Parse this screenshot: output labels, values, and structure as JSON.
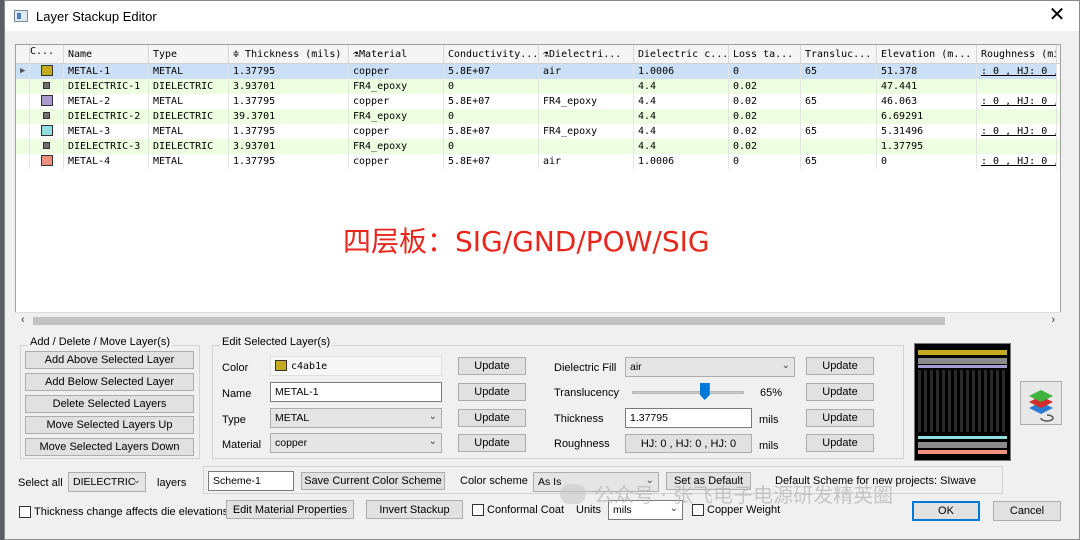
{
  "window": {
    "title": "Layer Stackup Editor"
  },
  "grid": {
    "headers": [
      "C...",
      "Name",
      "Type",
      "Thickness (mils)",
      "Material",
      "Conductivity...",
      "Dielectri...",
      "Dielectric c...",
      "Loss ta...",
      "Transluc...",
      "Elevation (m...",
      "Roughness (mi"
    ],
    "rows": [
      {
        "color": "#c4ab1e",
        "name": "METAL-1",
        "type": "METAL",
        "thickness": "1.37795",
        "material": "copper",
        "conductivity": "5.8E+07",
        "dielectric": "air",
        "dielectric_c": "1.0006",
        "loss": "0",
        "transluc": "65",
        "elevation": "51.378",
        "roughness": ": 0 , HJ: 0 ,"
      },
      {
        "color": "#707070",
        "name": "DIELECTRIC-1",
        "type": "DIELECTRIC",
        "thickness": "3.93701",
        "material": "FR4_epoxy",
        "conductivity": "0",
        "dielectric": "",
        "dielectric_c": "4.4",
        "loss": "0.02",
        "transluc": "",
        "elevation": "47.441",
        "roughness": ""
      },
      {
        "color": "#a89ad0",
        "name": "METAL-2",
        "type": "METAL",
        "thickness": "1.37795",
        "material": "copper",
        "conductivity": "5.8E+07",
        "dielectric": "FR4_epoxy",
        "dielectric_c": "4.4",
        "loss": "0.02",
        "transluc": "65",
        "elevation": "46.063",
        "roughness": ": 0 , HJ: 0 ,"
      },
      {
        "color": "#707070",
        "name": "DIELECTRIC-2",
        "type": "DIELECTRIC",
        "thickness": "39.3701",
        "material": "FR4_epoxy",
        "conductivity": "0",
        "dielectric": "",
        "dielectric_c": "4.4",
        "loss": "0.02",
        "transluc": "",
        "elevation": "6.69291",
        "roughness": ""
      },
      {
        "color": "#8ee0de",
        "name": "METAL-3",
        "type": "METAL",
        "thickness": "1.37795",
        "material": "copper",
        "conductivity": "5.8E+07",
        "dielectric": "FR4_epoxy",
        "dielectric_c": "4.4",
        "loss": "0.02",
        "transluc": "65",
        "elevation": "5.31496",
        "roughness": ": 0 , HJ: 0 ,"
      },
      {
        "color": "#707070",
        "name": "DIELECTRIC-3",
        "type": "DIELECTRIC",
        "thickness": "3.93701",
        "material": "FR4_epoxy",
        "conductivity": "0",
        "dielectric": "",
        "dielectric_c": "4.4",
        "loss": "0.02",
        "transluc": "",
        "elevation": "1.37795",
        "roughness": ""
      },
      {
        "color": "#f0907c",
        "name": "METAL-4",
        "type": "METAL",
        "thickness": "1.37795",
        "material": "copper",
        "conductivity": "5.8E+07",
        "dielectric": "air",
        "dielectric_c": "1.0006",
        "loss": "0",
        "transluc": "65",
        "elevation": "0",
        "roughness": ": 0 , HJ: 0 ,"
      }
    ]
  },
  "overlay_text": "四层板：SIG/GND/POW/SIG",
  "layers_group": {
    "label": "Add / Delete / Move Layer(s)",
    "add_above": "Add Above Selected Layer",
    "add_below": "Add Below Selected Layer",
    "delete": "Delete Selected Layers",
    "move_up": "Move Selected Layers Up",
    "move_down": "Move Selected Layers Down"
  },
  "edit_group": {
    "label": "Edit Selected Layer(s)",
    "color_label": "Color",
    "color_value": "c4ab1e",
    "color_hex": "#c4ab1e",
    "name_label": "Name",
    "name_value": "METAL-1",
    "type_label": "Type",
    "type_value": "METAL",
    "material_label": "Material",
    "material_value": "copper",
    "update": "Update",
    "dielectric_fill_label": "Dielectric Fill",
    "dielectric_fill_value": "air",
    "translucency_label": "Translucency",
    "translucency_value": "65%",
    "translucency_level": 0.65,
    "thickness_label": "Thickness",
    "thickness_value": "1.37795",
    "roughness_label": "Roughness",
    "roughness_value": "HJ: 0 , HJ: 0 , HJ: 0",
    "units": "mils"
  },
  "bottom": {
    "select_all": "Select all",
    "select_value": "DIELECTRIC",
    "layers": "layers",
    "scheme_value": "Scheme-1",
    "save_scheme": "Save Current Color Scheme",
    "color_scheme_label": "Color scheme",
    "color_scheme_value": "As Is",
    "set_default": "Set as Default",
    "default_scheme": "Default Scheme for new projects: SIwave",
    "thickness_change": "Thickness change affects die elevations",
    "edit_material": "Edit Material Properties",
    "invert": "Invert Stackup",
    "conformal": "Conformal Coat",
    "units_label": "Units",
    "units_value": "mils",
    "copper_weight": "Copper Weight",
    "ok": "OK",
    "cancel": "Cancel"
  },
  "watermark": "公众号 · 张飞电子电源研发精英圈"
}
